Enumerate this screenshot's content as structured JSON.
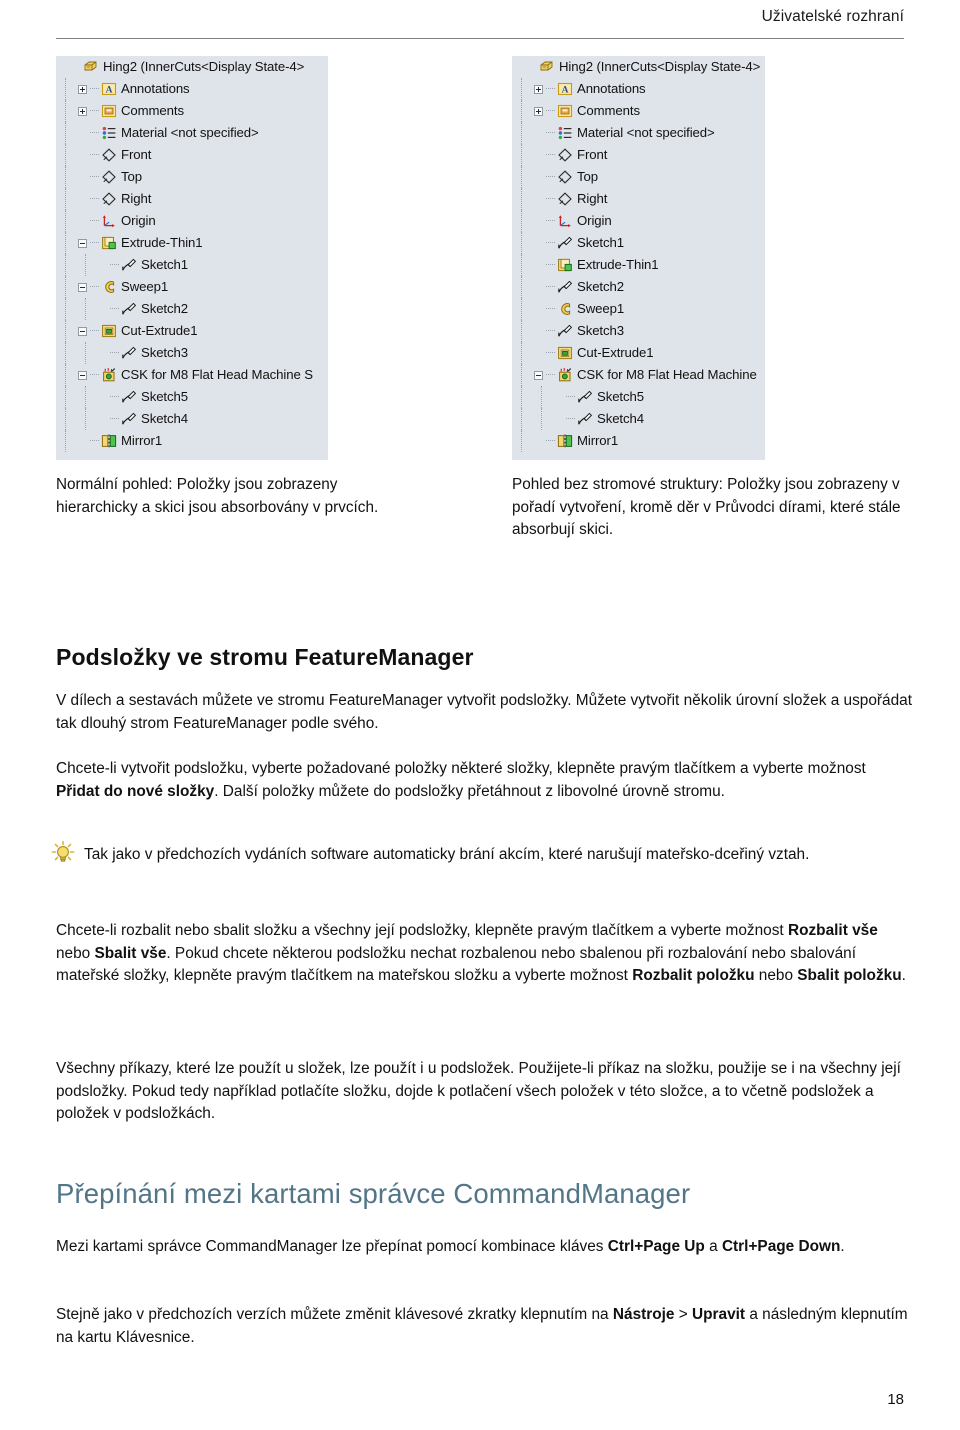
{
  "header": {
    "running_title": "Uživatelské rozhraní"
  },
  "figure": {
    "left_tree": {
      "nodes": [
        {
          "label": "Hing2  (InnerCuts<Display State-4>",
          "icon": "part-icon",
          "depth": 0,
          "toggle": "none"
        },
        {
          "label": "Annotations",
          "icon": "annotations-icon",
          "depth": 1,
          "toggle": "plus"
        },
        {
          "label": "Comments",
          "icon": "comments-icon",
          "depth": 1,
          "toggle": "plus"
        },
        {
          "label": "Material <not specified>",
          "icon": "material-icon",
          "depth": 1,
          "toggle": "none"
        },
        {
          "label": "Front",
          "icon": "plane-icon",
          "depth": 1,
          "toggle": "none"
        },
        {
          "label": "Top",
          "icon": "plane-icon",
          "depth": 1,
          "toggle": "none"
        },
        {
          "label": "Right",
          "icon": "plane-icon",
          "depth": 1,
          "toggle": "none"
        },
        {
          "label": "Origin",
          "icon": "origin-icon",
          "depth": 1,
          "toggle": "none"
        },
        {
          "label": "Extrude-Thin1",
          "icon": "extrude-icon",
          "depth": 1,
          "toggle": "minus"
        },
        {
          "label": "Sketch1",
          "icon": "sketch-icon",
          "depth": 2,
          "toggle": "none"
        },
        {
          "label": "Sweep1",
          "icon": "sweep-icon",
          "depth": 1,
          "toggle": "minus"
        },
        {
          "label": "Sketch2",
          "icon": "sketch-icon",
          "depth": 2,
          "toggle": "none"
        },
        {
          "label": "Cut-Extrude1",
          "icon": "cut-extrude-icon",
          "depth": 1,
          "toggle": "minus"
        },
        {
          "label": "Sketch3",
          "icon": "sketch-icon",
          "depth": 2,
          "toggle": "none"
        },
        {
          "label": "CSK for M8 Flat Head Machine S",
          "icon": "hole-wizard-icon",
          "depth": 1,
          "toggle": "minus"
        },
        {
          "label": "Sketch5",
          "icon": "sketch-icon",
          "depth": 2,
          "toggle": "none"
        },
        {
          "label": "Sketch4",
          "icon": "sketch-icon",
          "depth": 2,
          "toggle": "none"
        },
        {
          "label": "Mirror1",
          "icon": "mirror-icon",
          "depth": 1,
          "toggle": "none"
        }
      ]
    },
    "right_tree": {
      "nodes": [
        {
          "label": "Hing2  (InnerCuts<Display State-4>",
          "icon": "part-icon",
          "depth": 0,
          "toggle": "none"
        },
        {
          "label": "Annotations",
          "icon": "annotations-icon",
          "depth": 1,
          "toggle": "plus"
        },
        {
          "label": "Comments",
          "icon": "comments-icon",
          "depth": 1,
          "toggle": "plus"
        },
        {
          "label": "Material <not specified>",
          "icon": "material-icon",
          "depth": 1,
          "toggle": "none"
        },
        {
          "label": "Front",
          "icon": "plane-icon",
          "depth": 1,
          "toggle": "none"
        },
        {
          "label": "Top",
          "icon": "plane-icon",
          "depth": 1,
          "toggle": "none"
        },
        {
          "label": "Right",
          "icon": "plane-icon",
          "depth": 1,
          "toggle": "none"
        },
        {
          "label": "Origin",
          "icon": "origin-icon",
          "depth": 1,
          "toggle": "none"
        },
        {
          "label": "Sketch1",
          "icon": "sketch-icon",
          "depth": 1,
          "toggle": "none"
        },
        {
          "label": "Extrude-Thin1",
          "icon": "extrude-icon",
          "depth": 1,
          "toggle": "none"
        },
        {
          "label": "Sketch2",
          "icon": "sketch-icon",
          "depth": 1,
          "toggle": "none"
        },
        {
          "label": "Sweep1",
          "icon": "sweep-icon",
          "depth": 1,
          "toggle": "none"
        },
        {
          "label": "Sketch3",
          "icon": "sketch-icon",
          "depth": 1,
          "toggle": "none"
        },
        {
          "label": "Cut-Extrude1",
          "icon": "cut-extrude-icon",
          "depth": 1,
          "toggle": "none"
        },
        {
          "label": "CSK for M8 Flat Head Machine",
          "icon": "hole-wizard-icon",
          "depth": 1,
          "toggle": "minus"
        },
        {
          "label": "Sketch5",
          "icon": "sketch-icon",
          "depth": 2,
          "toggle": "none"
        },
        {
          "label": "Sketch4",
          "icon": "sketch-icon",
          "depth": 2,
          "toggle": "none"
        },
        {
          "label": "Mirror1",
          "icon": "mirror-icon",
          "depth": 1,
          "toggle": "none"
        }
      ]
    },
    "caption_left": "Normální pohled: Položky jsou zobrazeny hierarchicky a skici jsou absorbovány v prvcích.",
    "caption_right": "Pohled bez stromové struktury: Položky jsou zobrazeny v pořadí vytvoření, kromě děr v Průvodci dírami, které stále absorbují skici."
  },
  "sections": {
    "subfolders": {
      "heading": "Podsložky ve stromu FeatureManager",
      "p1": "V dílech a sestavách můžete ve stromu FeatureManager vytvořit podsložky. Můžete vytvořit několik úrovní složek a uspořádat tak dlouhý strom FeatureManager podle svého.",
      "p2_pre": "Chcete-li vytvořit podsložku, vyberte požadované položky některé složky, klepněte pravým tlačítkem a vyberte možnost ",
      "p2_b1": "Přidat do nové složky",
      "p2_post": ". Další položky můžete do podsložky přetáhnout z libovolné úrovně stromu.",
      "tip": "Tak jako v předchozích vydáních software automaticky brání akcím, které narušují mateřsko-dceřiný vztah.",
      "tip_icon": "lightbulb-icon",
      "p3_a": "Chcete-li rozbalit nebo sbalit složku a všechny její podsložky, klepněte pravým tlačítkem a vyberte možnost ",
      "p3_b1": "Rozbalit vše",
      "p3_b": " nebo ",
      "p3_b2": "Sbalit vše",
      "p3_c": ". Pokud chcete některou podsložku nechat rozbalenou nebo sbalenou při rozbalování nebo sbalování mateřské složky, klepněte pravým tlačítkem na mateřskou složku a vyberte možnost ",
      "p3_b3": "Rozbalit položku",
      "p3_d": " nebo ",
      "p3_b4": "Sbalit položku",
      "p3_e": ".",
      "p4": "Všechny příkazy, které lze použít u složek, lze použít i u podsložek. Použijete-li příkaz na složku, použije se i na všechny její podsložky. Pokud tedy například potlačíte složku, dojde k potlačení všech položek v této složce, a to včetně podsložek a položek v podsložkách."
    },
    "commandmanager": {
      "heading": "Přepínání mezi kartami správce CommandManager",
      "p1_a": "Mezi kartami správce CommandManager lze přepínat pomocí kombinace kláves ",
      "p1_b1": "Ctrl+Page Up",
      "p1_b": " a ",
      "p1_b2": "Ctrl+Page Down",
      "p1_c": ".",
      "p2_a": "Stejně jako v předchozích verzích můžete změnit klávesové zkratky klepnutím na ",
      "p2_b1": "Nástroje",
      "p2_b": " > ",
      "p2_b2": "Upravit",
      "p2_c": " a následným klepnutím na kartu Klávesnice."
    }
  },
  "footer": {
    "page_number": "18"
  },
  "colors": {
    "heading_blue": "#527588",
    "tree_background": "#dfe3ea",
    "rule": "#808080"
  }
}
